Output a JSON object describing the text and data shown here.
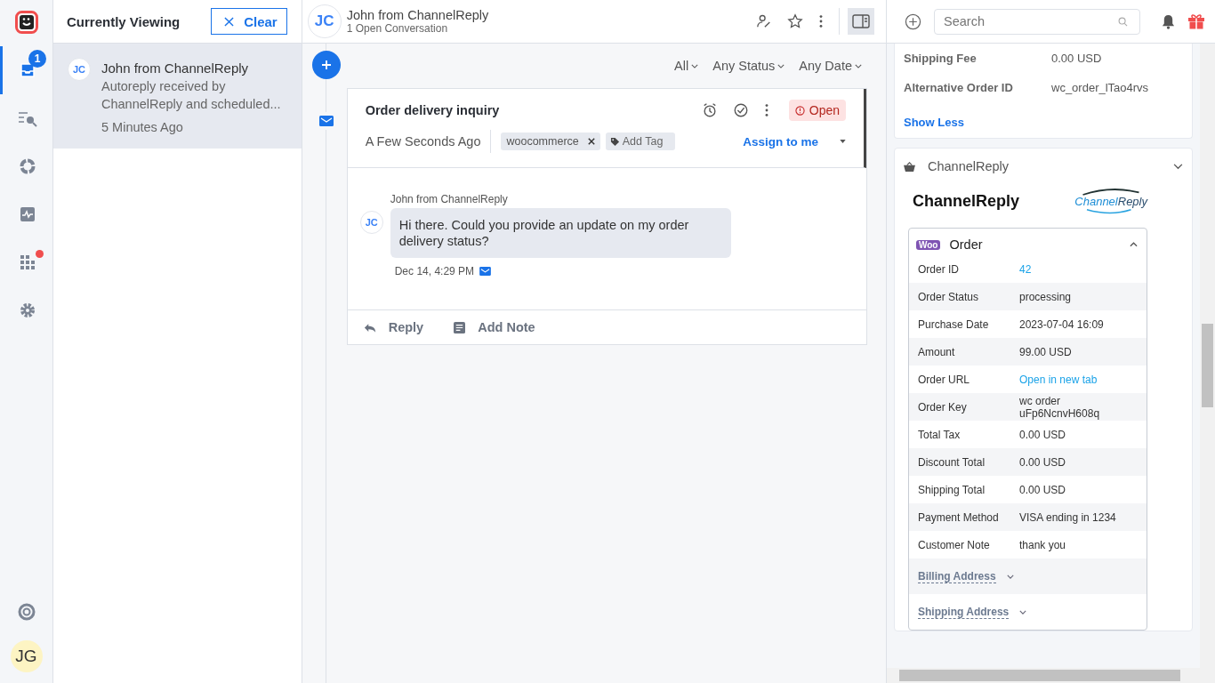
{
  "nav": {
    "items": [
      {
        "kind": "inbox",
        "selected": true,
        "badge": "1",
        "alert": false
      },
      {
        "kind": "search-list",
        "selected": false,
        "alert": false
      },
      {
        "kind": "reports",
        "selected": false,
        "alert": false
      },
      {
        "kind": "activity",
        "selected": false,
        "alert": false
      },
      {
        "kind": "apps",
        "selected": false,
        "alert": true
      },
      {
        "kind": "settings",
        "selected": false,
        "alert": false
      }
    ],
    "user_initials": "JG"
  },
  "list": {
    "title": "Currently Viewing",
    "clear_button": "Clear",
    "items": [
      {
        "initials": "JC",
        "name": "John from ChannelReply",
        "preview": "Autoreply received by ChannelReply and scheduled...",
        "time": "5 Minutes Ago",
        "selected": true
      }
    ]
  },
  "header": {
    "initials": "JC",
    "name": "John from ChannelReply",
    "subtitle": "1 Open Conversation",
    "panel_toggle_on": true
  },
  "filters": [
    "All",
    "Any Status",
    "Any Date"
  ],
  "conversation": {
    "subject": "Order delivery inquiry",
    "status": "Open",
    "time": "A Few Seconds Ago",
    "tags": [
      "woocommerce"
    ],
    "add_tag": "Add Tag",
    "assign": "Assign to me",
    "messages": [
      {
        "initials": "JC",
        "author": "John from ChannelReply",
        "text": "Hi there. Could you provide an update on my order delivery status?",
        "time": "Dec 14, 4:29 PM"
      }
    ],
    "actions": [
      {
        "kind": "reply",
        "label": "Reply"
      },
      {
        "kind": "note",
        "label": "Add Note"
      }
    ]
  },
  "topbar": {
    "search": {
      "placeholder": "Search"
    }
  },
  "details": {
    "fields": [
      {
        "label": "Shipping Fee",
        "value": "0.00 USD"
      },
      {
        "label": "Alternative Order ID",
        "value": "wc_order_lTao4rvs"
      }
    ],
    "show_less": "Show Less"
  },
  "integration": {
    "name": "ChannelReply",
    "title": "ChannelReply",
    "logo_a": "Channel",
    "logo_b": "Reply",
    "expanded": true,
    "order": {
      "badge": "Woo",
      "title": "Order",
      "expanded": true,
      "rows": [
        {
          "label": "Order ID",
          "value": "42",
          "link": true
        },
        {
          "label": "Order Status",
          "value": "processing",
          "link": false
        },
        {
          "label": "Purchase Date",
          "value": "2023-07-04 16:09",
          "link": false
        },
        {
          "label": "Amount",
          "value": "99.00 USD",
          "link": false
        },
        {
          "label": "Order URL",
          "value": "Open in new tab",
          "link": true
        },
        {
          "label": "Order Key",
          "value": "wc order uFp6NcnvH608q",
          "link": false
        },
        {
          "label": "Total Tax",
          "value": "0.00 USD",
          "link": false
        },
        {
          "label": "Discount Total",
          "value": "0.00 USD",
          "link": false
        },
        {
          "label": "Shipping Total",
          "value": "0.00 USD",
          "link": false
        },
        {
          "label": "Payment Method",
          "value": "VISA ending in 1234",
          "link": false
        },
        {
          "label": "Customer Note",
          "value": "thank you",
          "link": false
        }
      ],
      "sections": [
        {
          "label": "Billing Address",
          "expanded": false
        },
        {
          "label": "Shipping Address",
          "expanded": false
        }
      ]
    }
  }
}
